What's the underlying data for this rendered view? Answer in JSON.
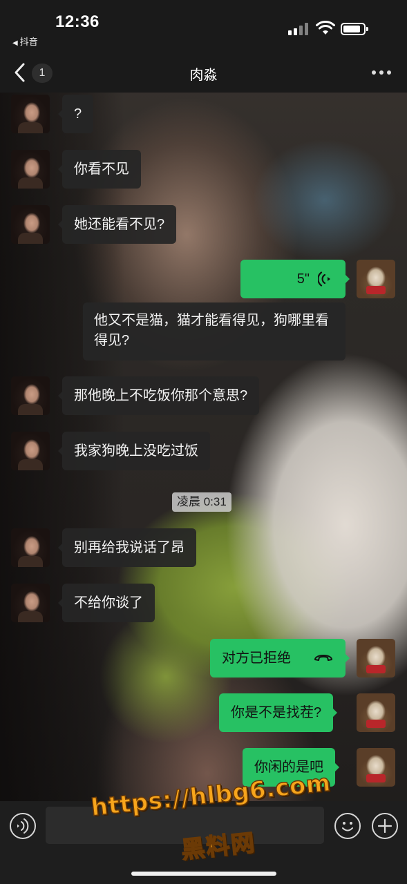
{
  "status_bar": {
    "time": "12:36",
    "back_app": "抖音",
    "back_app_icon": "left-triangle-icon"
  },
  "nav": {
    "unread_count": "1",
    "title": "肉淼",
    "back_icon": "chevron-left-icon",
    "more_icon": "ellipsis-icon"
  },
  "messages": [
    {
      "side": "in",
      "type": "text",
      "text": "?"
    },
    {
      "side": "in",
      "type": "text",
      "text": "你看不见"
    },
    {
      "side": "in",
      "type": "text",
      "text": "她还能看不见?"
    },
    {
      "side": "out",
      "type": "voice",
      "duration": "5\""
    },
    {
      "side": "out",
      "type": "text",
      "text": "他又不是猫，猫才能看得见，狗哪里看得见?"
    },
    {
      "side": "in",
      "type": "text",
      "text": "那他晚上不吃饭你那个意思?"
    },
    {
      "side": "in",
      "type": "text",
      "text": "我家狗晚上没吃过饭"
    },
    {
      "side": "system",
      "type": "timestamp",
      "text": "凌晨 0:31"
    },
    {
      "side": "in",
      "type": "text",
      "text": "别再给我说话了昂"
    },
    {
      "side": "in",
      "type": "text",
      "text": "不给你谈了"
    },
    {
      "side": "out",
      "type": "call",
      "text": "对方已拒绝"
    },
    {
      "side": "out",
      "type": "text",
      "text": "你是不是找茬?"
    },
    {
      "side": "out",
      "type": "text",
      "text": "你闲的是吧"
    }
  ],
  "input_bar": {
    "voice_icon": "voice-mode-icon",
    "text_value": "",
    "emoji_icon": "emoji-icon",
    "plus_icon": "plus-icon"
  },
  "watermark": {
    "url": "https://hlbg6.com",
    "name": "黑料网"
  },
  "colors": {
    "outgoing_bubble": "#27c163",
    "incoming_bubble": "#262626",
    "watermark": "#f7a51c"
  }
}
